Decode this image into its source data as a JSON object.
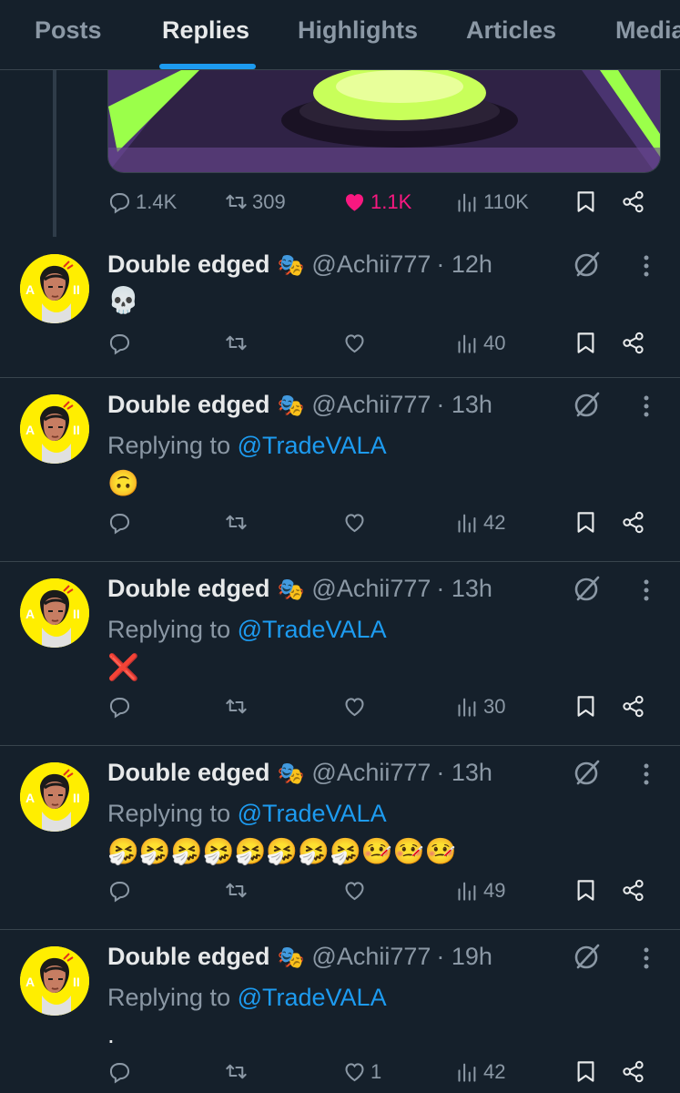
{
  "tabs": [
    "Posts",
    "Replies",
    "Highlights",
    "Articles",
    "Media"
  ],
  "active_tab": "Replies",
  "top_post": {
    "replies": "1.4K",
    "reposts": "309",
    "likes": "1.1K",
    "views": "110K"
  },
  "replies": [
    {
      "name": "Double edged",
      "name_emoji": "🎭",
      "handle": "@Achii777",
      "time": "· 12h",
      "replying_to": null,
      "content": "💀",
      "reply_count": "",
      "repost_count": "",
      "like_count": "",
      "views": "40"
    },
    {
      "name": "Double edged",
      "name_emoji": "🎭",
      "handle": "@Achii777",
      "time": "· 13h",
      "replying_to": "@TradeVALA",
      "content": "🙃",
      "reply_count": "",
      "repost_count": "",
      "like_count": "",
      "views": "42"
    },
    {
      "name": "Double edged",
      "name_emoji": "🎭",
      "handle": "@Achii777",
      "time": "· 13h",
      "replying_to": "@TradeVALA",
      "content": "❌",
      "reply_count": "",
      "repost_count": "",
      "like_count": "",
      "views": "30"
    },
    {
      "name": "Double edged",
      "name_emoji": "🎭",
      "handle": "@Achii777",
      "time": "· 13h",
      "replying_to": "@TradeVALA",
      "content": "🤧🤧🤧🤧🤧🤧🤧🤧🤒🤒🤒",
      "reply_count": "",
      "repost_count": "",
      "like_count": "",
      "views": "49"
    },
    {
      "name": "Double edged",
      "name_emoji": "🎭",
      "handle": "@Achii777",
      "time": "· 19h",
      "replying_to": "@TradeVALA",
      "content": ".",
      "reply_count": "",
      "repost_count": "",
      "like_count": "1",
      "views": "42"
    }
  ],
  "labels": {
    "replying_prefix": "Replying to "
  },
  "icons": {
    "reply": "reply-icon",
    "repost": "repost-icon",
    "like": "heart-icon",
    "views": "views-icon",
    "bookmark": "bookmark-icon",
    "share": "share-icon",
    "grok": "grok-icon",
    "more": "more-icon"
  },
  "colors": {
    "background": "#15202b",
    "accent": "#1d9bf0",
    "like": "#f91880",
    "muted": "#8b98a5",
    "avatar": "#ffee00"
  }
}
